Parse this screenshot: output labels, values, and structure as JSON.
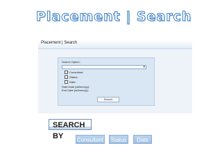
{
  "slide": {
    "title": "Placement | Search"
  },
  "app": {
    "header_title": "Placement | Search",
    "search_option_label": "Search Option:",
    "select_arrow": "▾",
    "checkboxes": [
      {
        "label": "Consultant:"
      },
      {
        "label": "Status:"
      },
      {
        "label": "Date:"
      }
    ],
    "start_date_label": "Start Date (dd/mm/yy):",
    "end_date_label": "End Date (dd/mm/yy):",
    "search_button": "Search"
  },
  "search_by": {
    "label": "SEARCH BY",
    "tags": [
      {
        "label": "Consultant"
      },
      {
        "label": "Status"
      },
      {
        "label": "Date"
      }
    ]
  },
  "colors": {
    "title_outline": "#3d7fc4",
    "panel_bg": "#d9e6f3",
    "tag_bg": "#a9c8e8"
  }
}
